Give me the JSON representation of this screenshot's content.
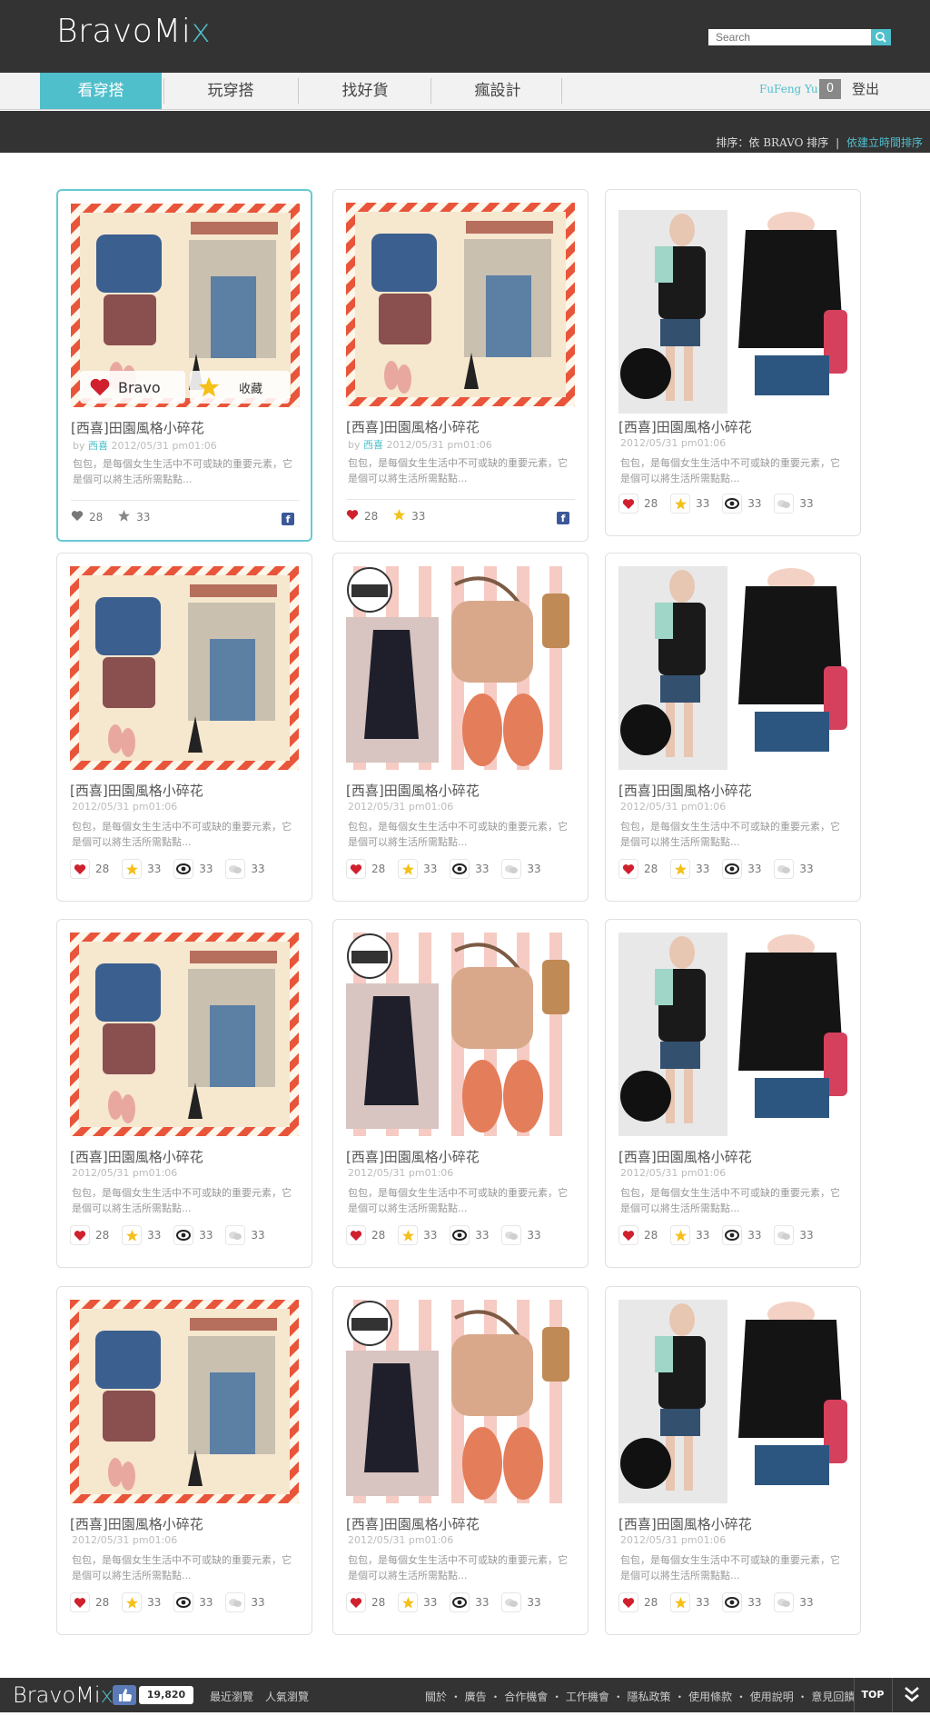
{
  "header": {
    "logo_main": "BravoMi",
    "logo_accent": "x",
    "search_placeholder": "Search"
  },
  "nav": {
    "items": [
      "看穿搭",
      "玩穿搭",
      "找好貨",
      "瘋設計"
    ],
    "active_index": 0,
    "user_name": "FuFeng Yu",
    "notification_count": "0",
    "logout_label": "登出"
  },
  "sortbar": {
    "current": "排序：依 BRAVO 排序",
    "separator": "|",
    "alternative": "依建立時間排序"
  },
  "overlay": {
    "bravo_label": "Bravo",
    "collect_label": "收藏"
  },
  "cards": [
    {
      "title": "[西喜]田園風格小碎花",
      "by": "by",
      "author": "西喜",
      "date": "2012/05/31 pm01:06",
      "desc": "包包，是每個女生生活中不可或缺的重要元素，它是個可以將生活所需點點...",
      "hearts": "28",
      "stars": "33",
      "views": "",
      "comments": "",
      "image": "postcard"
    },
    {
      "title": "[西喜]田園風格小碎花",
      "by": "by",
      "author": "西喜",
      "date": "2012/05/31 pm01:06",
      "desc": "包包，是每個女生生活中不可或缺的重要元素，它是個可以將生活所需點點...",
      "hearts": "28",
      "stars": "33",
      "views": "",
      "comments": "",
      "image": "postcard"
    },
    {
      "title": "[西喜]田園風格小碎花",
      "by": "",
      "author": "",
      "date": "2012/05/31 pm01:06",
      "desc": "包包，是每個女生生活中不可或缺的重要元素，它是個可以將生活所需點點...",
      "hearts": "28",
      "stars": "33",
      "views": "33",
      "comments": "33",
      "image": "black"
    },
    {
      "title": "[西喜]田園風格小碎花",
      "by": "",
      "author": "",
      "date": "2012/05/31 pm01:06",
      "desc": "包包，是每個女生生活中不可或缺的重要元素，它是個可以將生活所需點點...",
      "hearts": "28",
      "stars": "33",
      "views": "33",
      "comments": "33",
      "image": "postcard"
    },
    {
      "title": "[西喜]田園風格小碎花",
      "by": "",
      "author": "",
      "date": "2012/05/31 pm01:06",
      "desc": "包包，是每個女生生活中不可或缺的重要元素，它是個可以將生活所需點點...",
      "hearts": "28",
      "stars": "33",
      "views": "33",
      "comments": "33",
      "image": "hot"
    },
    {
      "title": "[西喜]田園風格小碎花",
      "by": "",
      "author": "",
      "date": "2012/05/31 pm01:06",
      "desc": "包包，是每個女生生活中不可或缺的重要元素，它是個可以將生活所需點點...",
      "hearts": "28",
      "stars": "33",
      "views": "33",
      "comments": "33",
      "image": "black"
    },
    {
      "title": "[西喜]田園風格小碎花",
      "by": "",
      "author": "",
      "date": "2012/05/31 pm01:06",
      "desc": "包包，是每個女生生活中不可或缺的重要元素，它是個可以將生活所需點點...",
      "hearts": "28",
      "stars": "33",
      "views": "33",
      "comments": "33",
      "image": "postcard"
    },
    {
      "title": "[西喜]田園風格小碎花",
      "by": "",
      "author": "",
      "date": "2012/05/31 pm01:06",
      "desc": "包包，是每個女生生活中不可或缺的重要元素，它是個可以將生活所需點點...",
      "hearts": "28",
      "stars": "33",
      "views": "33",
      "comments": "33",
      "image": "hot"
    },
    {
      "title": "[西喜]田園風格小碎花",
      "by": "",
      "author": "",
      "date": "2012/05/31 pm01:06",
      "desc": "包包，是每個女生生活中不可或缺的重要元素，它是個可以將生活所需點點...",
      "hearts": "28",
      "stars": "33",
      "views": "33",
      "comments": "33",
      "image": "black"
    },
    {
      "title": "[西喜]田園風格小碎花",
      "by": "",
      "author": "",
      "date": "2012/05/31 pm01:06",
      "desc": "包包，是每個女生生活中不可或缺的重要元素，它是個可以將生活所需點點...",
      "hearts": "28",
      "stars": "33",
      "views": "33",
      "comments": "33",
      "image": "postcard"
    },
    {
      "title": "[西喜]田園風格小碎花",
      "by": "",
      "author": "",
      "date": "2012/05/31 pm01:06",
      "desc": "包包，是每個女生生活中不可或缺的重要元素，它是個可以將生活所需點點...",
      "hearts": "28",
      "stars": "33",
      "views": "33",
      "comments": "33",
      "image": "hot"
    },
    {
      "title": "[西喜]田園風格小碎花",
      "by": "",
      "author": "",
      "date": "2012/05/31 pm01:06",
      "desc": "包包，是每個女生生活中不可或缺的重要元素，它是個可以將生活所需點點...",
      "hearts": "28",
      "stars": "33",
      "views": "33",
      "comments": "33",
      "image": "black"
    }
  ],
  "footer": {
    "logo_main": "BravoMi",
    "logo_accent": "x",
    "like_count": "19,820",
    "recent": "最近瀏覽",
    "popular": "人氣瀏覽",
    "links": "關於 ・ 廣告 ・ 合作機會 ・ 工作機會 ・ 隱私政策 ・ 使用條款 ・ 使用說明 ・ 意見回饋",
    "top_label": "TOP"
  },
  "colors": {
    "accent": "#4fbfcb",
    "dark_bar": "#333333",
    "heart": "#d0202e",
    "star": "#f5c01a",
    "facebook": "#3b5998"
  },
  "icons": [
    "search-icon",
    "heart-icon",
    "star-icon",
    "eye-icon",
    "comment-icon",
    "facebook-icon",
    "thumbs-up-icon",
    "chevron-double-down-icon"
  ]
}
